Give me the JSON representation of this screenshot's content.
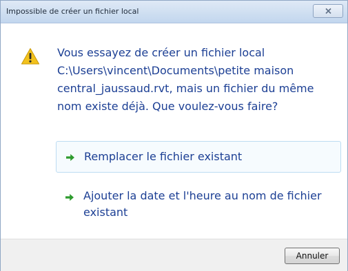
{
  "window": {
    "title": "Impossible de créer un fichier local"
  },
  "icons": {
    "close": "close-icon",
    "warning": "warning-icon",
    "option_arrow": "green-arrow-icon"
  },
  "message": {
    "lines": [
      "Vous essayez de créer un fichier local",
      "C:\\Users\\vincent\\Documents\\petite maison",
      "central_jaussaud.rvt, mais un fichier du même",
      "nom existe déjà. Que voulez-vous faire?"
    ]
  },
  "options": [
    {
      "label": "Remplacer le fichier existant",
      "selected": true
    },
    {
      "label": "Ajouter la date et l'heure au nom de fichier existant",
      "selected": false
    }
  ],
  "footer": {
    "cancel_label": "Annuler"
  },
  "colors": {
    "text_blue": "#1c3f94",
    "arrow_green": "#2e9b2e",
    "warning_yellow": "#f2c11c",
    "titlebar": "#cfdff1"
  }
}
